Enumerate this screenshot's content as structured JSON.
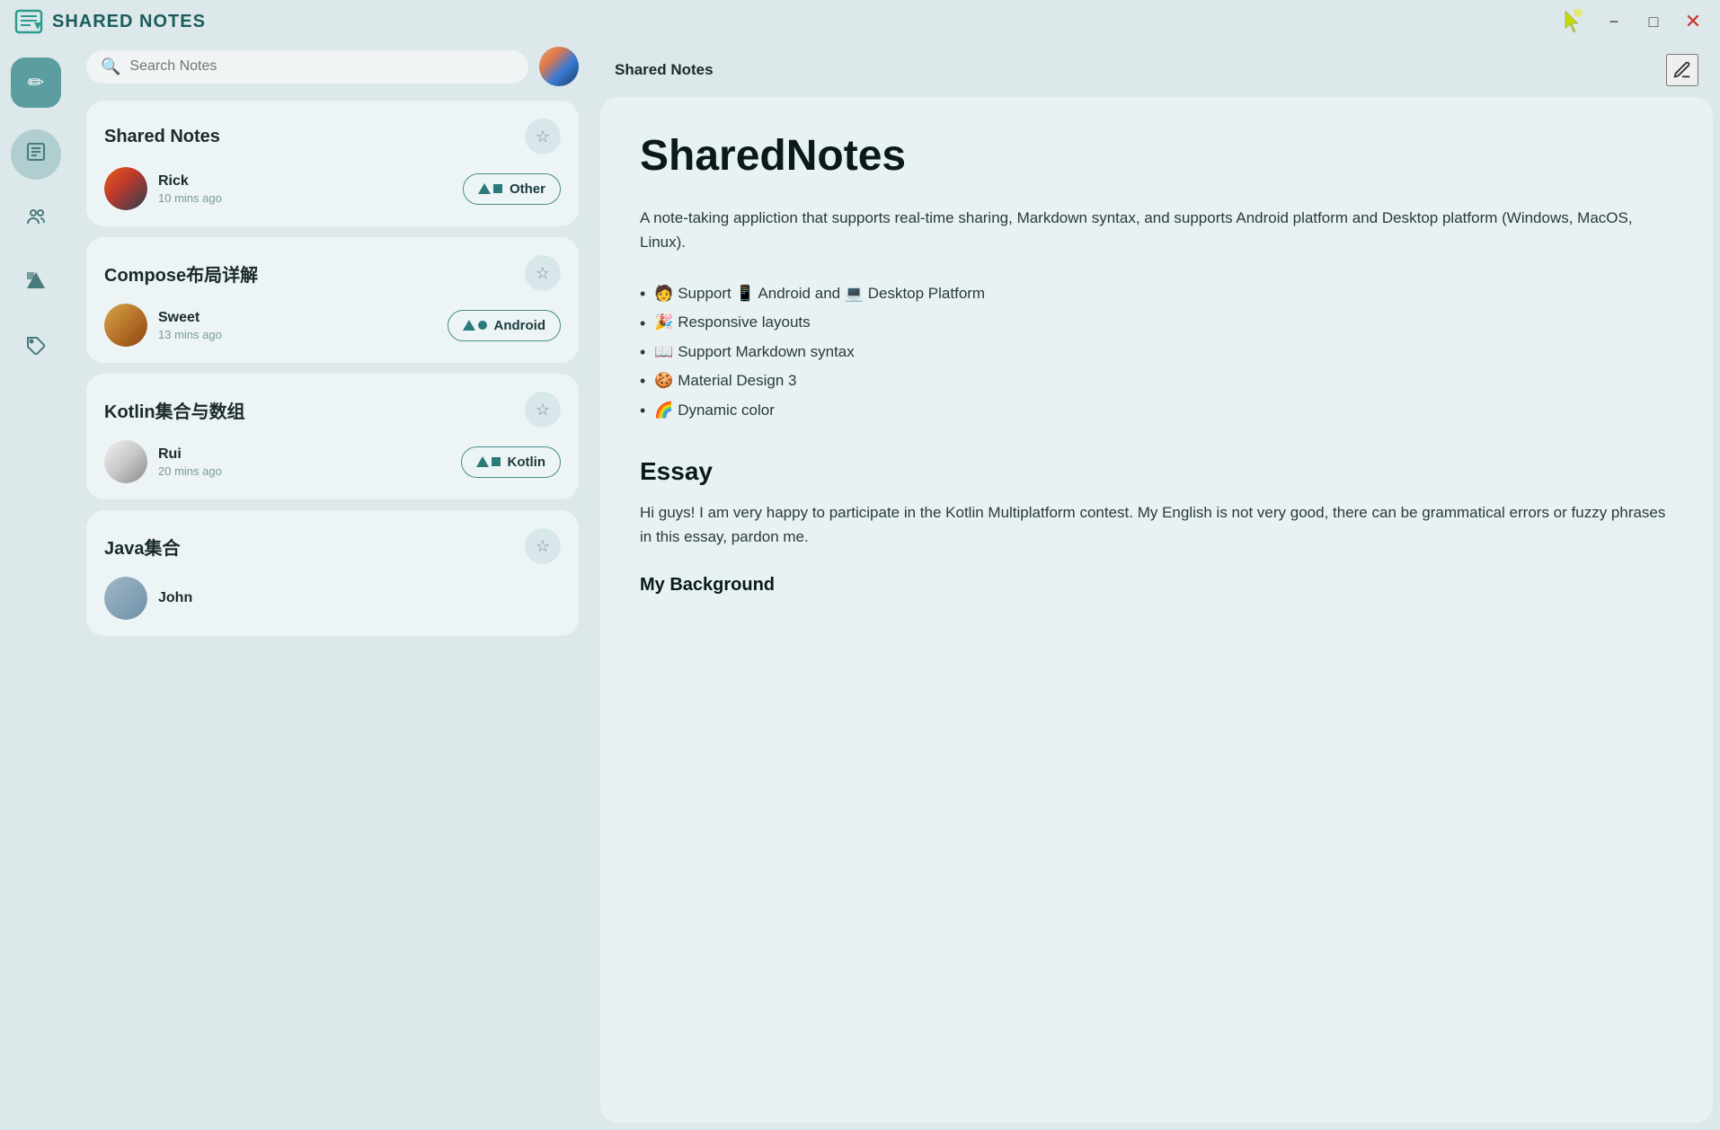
{
  "titleBar": {
    "title": "SHARED NOTES",
    "minimize": "−",
    "maximize": "□",
    "close": "✕"
  },
  "search": {
    "placeholder": "Search Notes"
  },
  "sidebar": {
    "fab_icon": "✏",
    "items": [
      {
        "icon": "☰",
        "label": "notes",
        "active": true
      },
      {
        "icon": "👥",
        "label": "people",
        "active": false
      },
      {
        "icon": "▲",
        "label": "shapes",
        "active": false
      },
      {
        "icon": "🏷",
        "label": "tags",
        "active": false
      }
    ]
  },
  "notes": [
    {
      "title": "Shared Notes",
      "author": "Rick",
      "time": "10 mins ago",
      "tag": "Other",
      "avatarType": "rick"
    },
    {
      "title": "Compose布局详解",
      "author": "Sweet",
      "time": "13 mins ago",
      "tag": "Android",
      "avatarType": "sweet"
    },
    {
      "title": "Kotlin集合与数组",
      "author": "Rui",
      "time": "20 mins ago",
      "tag": "Kotlin",
      "avatarType": "rui"
    },
    {
      "title": "Java集合",
      "author": "John",
      "time": "",
      "tag": "",
      "avatarType": "john"
    }
  ],
  "content": {
    "headerTitle": "Shared Notes",
    "mainTitle": "SharedNotes",
    "description": "A note-taking appliction that supports real-time sharing, Markdown syntax, and supports Android platform and Desktop platform (Windows, MacOS, Linux).",
    "features": [
      "🧑 Support 📱 Android and 💻 Desktop Platform",
      "🎉 Responsive layouts",
      "📖 Support Markdown syntax",
      "🍪 Material Design 3",
      "🌈 Dynamic color"
    ],
    "essayTitle": "Essay",
    "essayText": "Hi guys! I am very happy to participate in the Kotlin Multiplatform contest. My English is not very good, there can be grammatical errors or fuzzy phrases in this essay, pardon me.",
    "bgTitle": "My Background"
  }
}
